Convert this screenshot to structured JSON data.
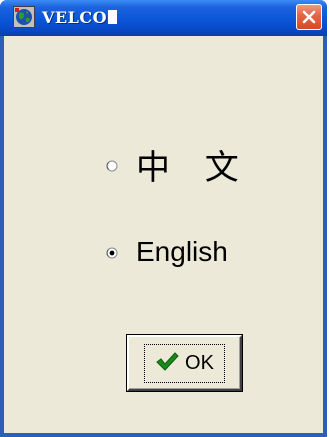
{
  "window": {
    "title": "VELCO"
  },
  "language_options": [
    {
      "label": "中 文",
      "selected": false
    },
    {
      "label": "English",
      "selected": true
    }
  ],
  "buttons": {
    "ok_label": "OK"
  },
  "colors": {
    "titlebar": "#0a55d8",
    "window_frame": "#2e5fb8",
    "dialog_bg": "#ece9d8",
    "close_button": "#e26848",
    "check_green": "#1a8a1a"
  }
}
